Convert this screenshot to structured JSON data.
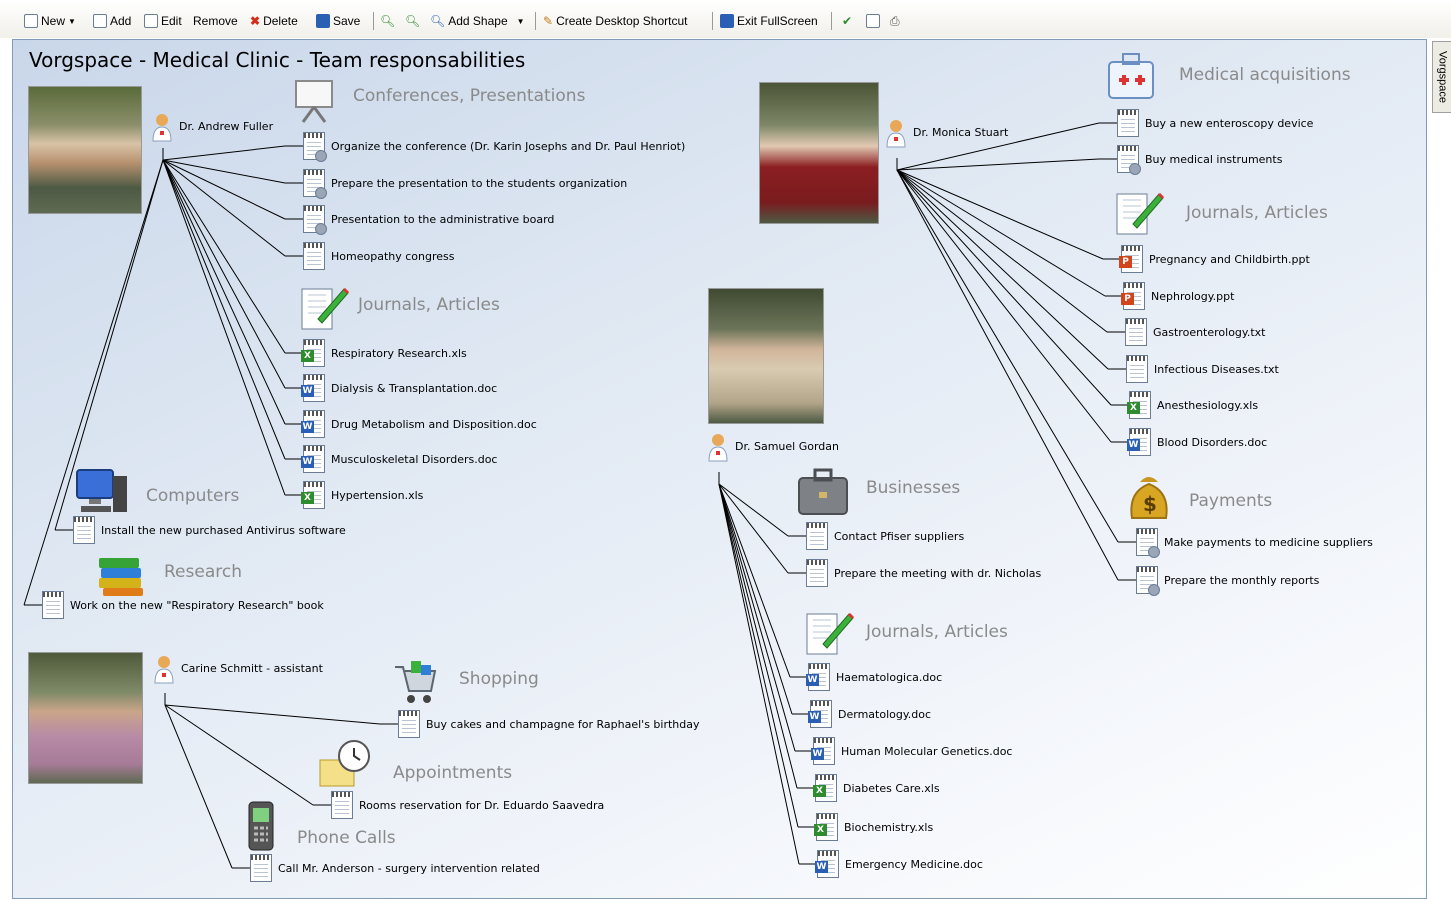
{
  "toolbar": {
    "new": "New",
    "add": "Add",
    "edit": "Edit",
    "remove": "Remove",
    "delete": "Delete",
    "save": "Save",
    "add_shape": "Add Shape",
    "create_shortcut": "Create Desktop Shortcut",
    "exit_fullscreen": "Exit FullScreen"
  },
  "side_tab": "Vorgspace",
  "title": "Vorgspace - Medical Clinic - Team responsabilities",
  "people": {
    "fuller": "Dr. Andrew Fuller",
    "stuart": "Dr. Monica Stuart",
    "gordan": "Dr. Samuel Gordan",
    "schmitt": "Carine Schmitt - assistant"
  },
  "categories": {
    "fuller_conf": "Conferences, Presentations",
    "fuller_journals": "Journals, Articles",
    "fuller_computers": "Computers",
    "fuller_research": "Research",
    "stuart_acq": "Medical acquisitions",
    "stuart_journals": "Journals, Articles",
    "stuart_payments": "Payments",
    "gordan_business": "Businesses",
    "gordan_journals": "Journals, Articles",
    "schmitt_shopping": "Shopping",
    "schmitt_appointments": "Appointments",
    "schmitt_phone": "Phone Calls"
  },
  "items": {
    "f1": "Organize the conference (Dr. Karin Josephs and Dr. Paul Henriot)",
    "f2": "Prepare the presentation to the students organization",
    "f3": "Presentation to the administrative board",
    "f4": "Homeopathy congress",
    "f5": "Respiratory Research.xls",
    "f6": "Dialysis & Transplantation.doc",
    "f7": "Drug Metabolism and Disposition.doc",
    "f8": "Musculoskeletal Disorders.doc",
    "f9": "Hypertension.xls",
    "f10": "Install the new purchased Antivirus software",
    "f11": "Work on the new \"Respiratory Research\" book",
    "s1": "Buy a new enteroscopy device",
    "s2": "Buy medical instruments",
    "s3": "Pregnancy and Childbirth.ppt",
    "s4": "Nephrology.ppt",
    "s5": "Gastroenterology.txt",
    "s6": "Infectious Diseases.txt",
    "s7": "Anesthesiology.xls",
    "s8": "Blood Disorders.doc",
    "s9": "Make payments to medicine suppliers",
    "s10": "Prepare the monthly reports",
    "g1": "Contact Pfiser suppliers",
    "g2": "Prepare the meeting with dr. Nicholas",
    "g3": "Haematologica.doc",
    "g4": "Dermatology.doc",
    "g5": "Human Molecular Genetics.doc",
    "g6": "Diabetes Care.xls",
    "g7": "Biochemistry.xls",
    "g8": "Emergency Medicine.doc",
    "c1": "Buy cakes and champagne for Raphael's birthday",
    "c2": "Rooms reservation for Dr. Eduardo Saavedra",
    "c3": "Call Mr. Anderson - surgery intervention related"
  },
  "colors": {
    "word": "#2b5fb4",
    "excel": "#2e8b2e",
    "ppt": "#d0451b",
    "line": "#000000"
  }
}
